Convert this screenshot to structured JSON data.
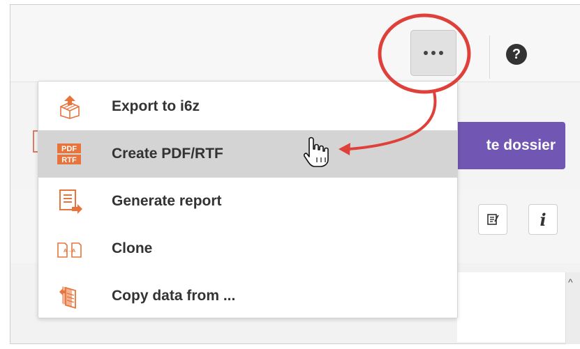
{
  "toolbar": {
    "more_label": "...",
    "help_label": "?"
  },
  "background": {
    "create_button_label": "te dossier",
    "info_label": "i"
  },
  "menu": {
    "items": [
      {
        "label": "Export to i6z",
        "icon": "export-box-icon"
      },
      {
        "label": "Create PDF/RTF",
        "icon": "pdf-rtf-icon",
        "icon_text_top": "PDF",
        "icon_text_bottom": "RTF"
      },
      {
        "label": "Generate report",
        "icon": "report-icon"
      },
      {
        "label": "Clone",
        "icon": "clone-icon",
        "icon_text": "A→A"
      },
      {
        "label": "Copy data from ...",
        "icon": "copy-data-icon"
      }
    ]
  },
  "colors": {
    "accent_orange": "#e8743b",
    "purple": "#7256b3",
    "annotation_red": "#e0403a",
    "hover_gray": "#d4d4d4"
  }
}
